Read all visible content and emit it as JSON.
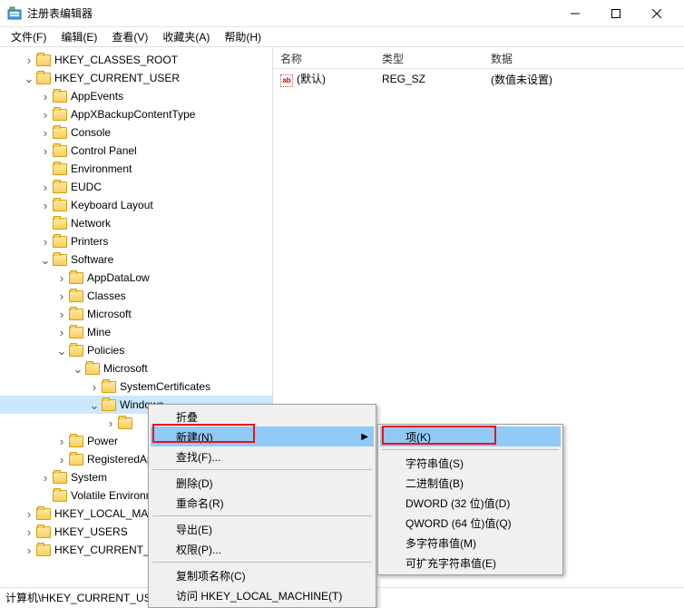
{
  "window": {
    "title": "注册表编辑器"
  },
  "menu": {
    "file": "文件(F)",
    "edit": "编辑(E)",
    "view": "查看(V)",
    "fav": "收藏夹(A)",
    "help": "帮助(H)"
  },
  "tree": [
    {
      "d": 1,
      "t": ">",
      "l": "HKEY_CLASSES_ROOT"
    },
    {
      "d": 1,
      "t": "v",
      "l": "HKEY_CURRENT_USER"
    },
    {
      "d": 2,
      "t": ">",
      "l": "AppEvents"
    },
    {
      "d": 2,
      "t": ">",
      "l": "AppXBackupContentType"
    },
    {
      "d": 2,
      "t": ">",
      "l": "Console"
    },
    {
      "d": 2,
      "t": ">",
      "l": "Control Panel"
    },
    {
      "d": 2,
      "t": "",
      "l": "Environment"
    },
    {
      "d": 2,
      "t": ">",
      "l": "EUDC"
    },
    {
      "d": 2,
      "t": ">",
      "l": "Keyboard Layout"
    },
    {
      "d": 2,
      "t": "",
      "l": "Network"
    },
    {
      "d": 2,
      "t": ">",
      "l": "Printers"
    },
    {
      "d": 2,
      "t": "v",
      "l": "Software"
    },
    {
      "d": 3,
      "t": ">",
      "l": "AppDataLow"
    },
    {
      "d": 3,
      "t": ">",
      "l": "Classes"
    },
    {
      "d": 3,
      "t": ">",
      "l": "Microsoft"
    },
    {
      "d": 3,
      "t": ">",
      "l": "Mine"
    },
    {
      "d": 3,
      "t": "v",
      "l": "Policies"
    },
    {
      "d": 4,
      "t": "v",
      "l": "Microsoft"
    },
    {
      "d": 5,
      "t": ">",
      "l": "SystemCertificates"
    },
    {
      "d": 5,
      "t": "v",
      "l": "Windows",
      "sel": true
    },
    {
      "d": 6,
      "t": ">",
      "l": ""
    },
    {
      "d": 3,
      "t": ">",
      "l": "Power"
    },
    {
      "d": 3,
      "t": ">",
      "l": "RegisteredApp"
    },
    {
      "d": 2,
      "t": ">",
      "l": "System"
    },
    {
      "d": 2,
      "t": "",
      "l": "Volatile Environment"
    },
    {
      "d": 1,
      "t": ">",
      "l": "HKEY_LOCAL_MACHINE"
    },
    {
      "d": 1,
      "t": ">",
      "l": "HKEY_USERS"
    },
    {
      "d": 1,
      "t": ">",
      "l": "HKEY_CURRENT_CONFIG"
    }
  ],
  "list": {
    "headers": {
      "name": "名称",
      "type": "类型",
      "data": "数据"
    },
    "rows": [
      {
        "name": "(默认)",
        "type": "REG_SZ",
        "data": "(数值未设置)"
      }
    ]
  },
  "statusbar": "计算机\\HKEY_CURRENT_US",
  "ctx1": {
    "collapse": "折叠",
    "new": "新建(N)",
    "find": "查找(F)...",
    "delete": "删除(D)",
    "rename": "重命名(R)",
    "export": "导出(E)",
    "perm": "权限(P)...",
    "copyname": "复制项名称(C)",
    "goto": "访问 HKEY_LOCAL_MACHINE(T)"
  },
  "ctx2": {
    "key": "项(K)",
    "string": "字符串值(S)",
    "binary": "二进制值(B)",
    "dword": "DWORD (32 位)值(D)",
    "qword": "QWORD (64 位)值(Q)",
    "multi": "多字符串值(M)",
    "expand": "可扩充字符串值(E)"
  }
}
